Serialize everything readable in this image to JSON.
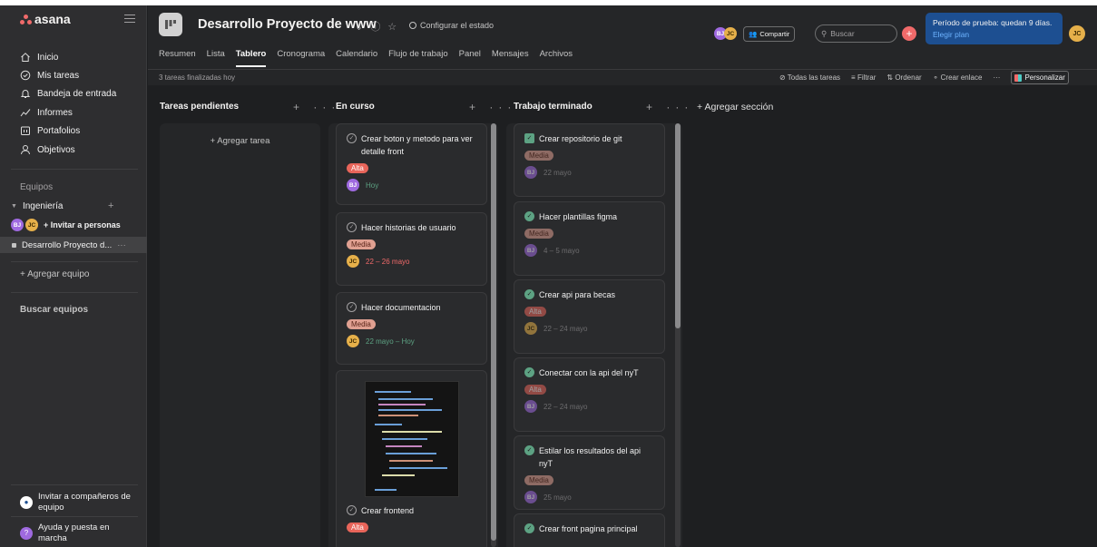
{
  "brand": {
    "logo_text": "asana",
    "logo_color": "#f06a6a"
  },
  "sidebar": {
    "nav": [
      {
        "label": "Inicio",
        "icon": "home-icon"
      },
      {
        "label": "Mis tareas",
        "icon": "check-circle-icon"
      },
      {
        "label": "Bandeja de entrada",
        "icon": "bell-icon"
      },
      {
        "label": "Informes",
        "icon": "chart-line-icon"
      },
      {
        "label": "Portafolios",
        "icon": "folder-icon"
      },
      {
        "label": "Objetivos",
        "icon": "person-icon"
      }
    ],
    "teams_heading": "Equipos",
    "team_name": "Ingeniería",
    "invite_people": "Invitar a personas",
    "project_item": "Desarrollo Proyecto d...",
    "add_team": "+ Agregar equipo",
    "search_teams": "Buscar equipos",
    "invite_teammates": "Invitar a compañeros de equipo",
    "help": "Ayuda y puesta en marcha"
  },
  "header": {
    "project_title": "Desarrollo Proyecto de www",
    "status_label": "Configurar el estado",
    "tabs": [
      "Resumen",
      "Lista",
      "Tablero",
      "Cronograma",
      "Calendario",
      "Flujo de trabajo",
      "Panel",
      "Mensajes",
      "Archivos"
    ],
    "active_tab": "Tablero",
    "members": [
      "BJ",
      "JC"
    ],
    "share_label": "Compartir",
    "search_placeholder": "Buscar",
    "trial_text": "Período de prueba: quedan 9 días.",
    "trial_plan": "Elegir plan",
    "user_initials": "JC",
    "finished_text": "3 tareas finalizadas hoy",
    "toolbar": {
      "all_tasks": "Todas las tareas",
      "filter": "Filtrar",
      "sort": "Ordenar",
      "create_link": "Crear enlace",
      "customize": "Personalizar"
    }
  },
  "board": {
    "add_section": "+ Agregar sección",
    "columns": [
      {
        "title": "Tareas pendientes",
        "add_task": "+ Agregar tarea"
      },
      {
        "title": "En curso",
        "cards": [
          {
            "title": "Crear boton y metodo para ver detalle front",
            "tag": "Alta",
            "assignee": "BJ",
            "date": "Hoy"
          },
          {
            "title": "Hacer historias de usuario",
            "tag": "Media",
            "assignee": "JC",
            "date": "22 – 26 mayo"
          },
          {
            "title": "Hacer documentacion",
            "tag": "Media",
            "assignee": "JC",
            "date": "22 mayo – Hoy"
          },
          {
            "title": "Crear frontend",
            "tag": "Alta"
          }
        ]
      },
      {
        "title": "Trabajo terminado",
        "cards": [
          {
            "title": "Crear repositorio de git",
            "tag": "Media",
            "assignee": "BJ",
            "date": "22 mayo"
          },
          {
            "title": "Hacer plantillas figma",
            "tag": "Media",
            "assignee": "BJ",
            "date": "4 – 5 mayo"
          },
          {
            "title": "Crear api para becas",
            "tag": "Alta",
            "assignee": "JC",
            "date": "22 – 24 mayo"
          },
          {
            "title": "Conectar con la api del nyT",
            "tag": "Alta",
            "assignee": "BJ",
            "date": "22 – 24 mayo"
          },
          {
            "title": "Estilar los resultados del api nyT",
            "tag": "Media",
            "assignee": "BJ",
            "date": "25 mayo"
          },
          {
            "title": "Crear front pagina principal"
          }
        ]
      }
    ]
  }
}
